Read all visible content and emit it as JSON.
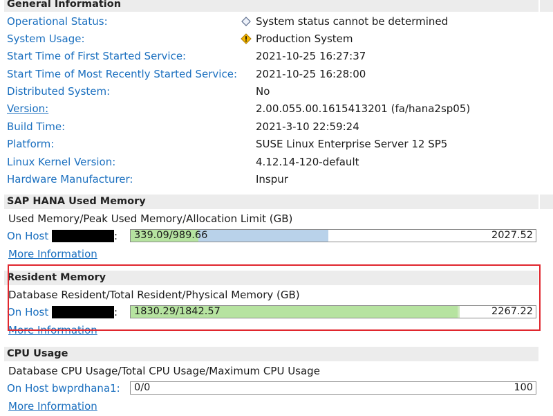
{
  "general": {
    "title": "General Information",
    "rows": [
      {
        "label": "Operational Status:",
        "value": "System status cannot be determined",
        "icon": "diamond-icon"
      },
      {
        "label": "System Usage:",
        "value": "Production System",
        "icon": "warning-icon"
      },
      {
        "label": "Start Time of First Started Service:",
        "value": "2021-10-25 16:27:37"
      },
      {
        "label": "Start Time of Most Recently Started Service:",
        "value": "2021-10-25 16:28:00"
      },
      {
        "label": "Distributed System:",
        "value": "No"
      },
      {
        "label": "Version:",
        "value": "2.00.055.00.1615413201 (fa/hana2sp05)"
      },
      {
        "label": "Build Time:",
        "value": "2021-3-10 22:59:24"
      },
      {
        "label": "Platform:",
        "value": "SUSE Linux Enterprise Server 12 SP5"
      },
      {
        "label": "Linux Kernel Version:",
        "value": "4.12.14-120-default"
      },
      {
        "label": "Hardware Manufacturer:",
        "value": "Inspur"
      }
    ]
  },
  "used_memory": {
    "title": "SAP HANA Used Memory",
    "subtitle": "Used Memory/Peak Used Memory/Allocation Limit (GB)",
    "host_label": "On Host",
    "colon": ":",
    "bar_value": "339.09/989.66",
    "bar_max": "2027.52",
    "used_fraction": 0.167,
    "peak_fraction": 0.488,
    "more": "More Information"
  },
  "resident_memory": {
    "title": "Resident Memory",
    "subtitle": "Database Resident/Total Resident/Physical Memory (GB)",
    "host_label": "On Host",
    "colon": ":",
    "bar_value": "1830.29/1842.57",
    "bar_max": "2267.22",
    "resident_fraction": 0.807,
    "total_fraction": 0.813,
    "more": "More Information"
  },
  "cpu": {
    "title": "CPU Usage",
    "subtitle": "Database CPU Usage/Total CPU Usage/Maximum CPU Usage",
    "host_label": "On Host bwprdhana1:",
    "bar_value": "0/0",
    "bar_max": "100",
    "more": "More Information"
  },
  "colors": {
    "link": "#1a6fbf",
    "header_bg": "#ececec",
    "green_fill": "#b6e3a0",
    "blue_fill": "#b9d2ea",
    "highlight": "#e0262d"
  }
}
